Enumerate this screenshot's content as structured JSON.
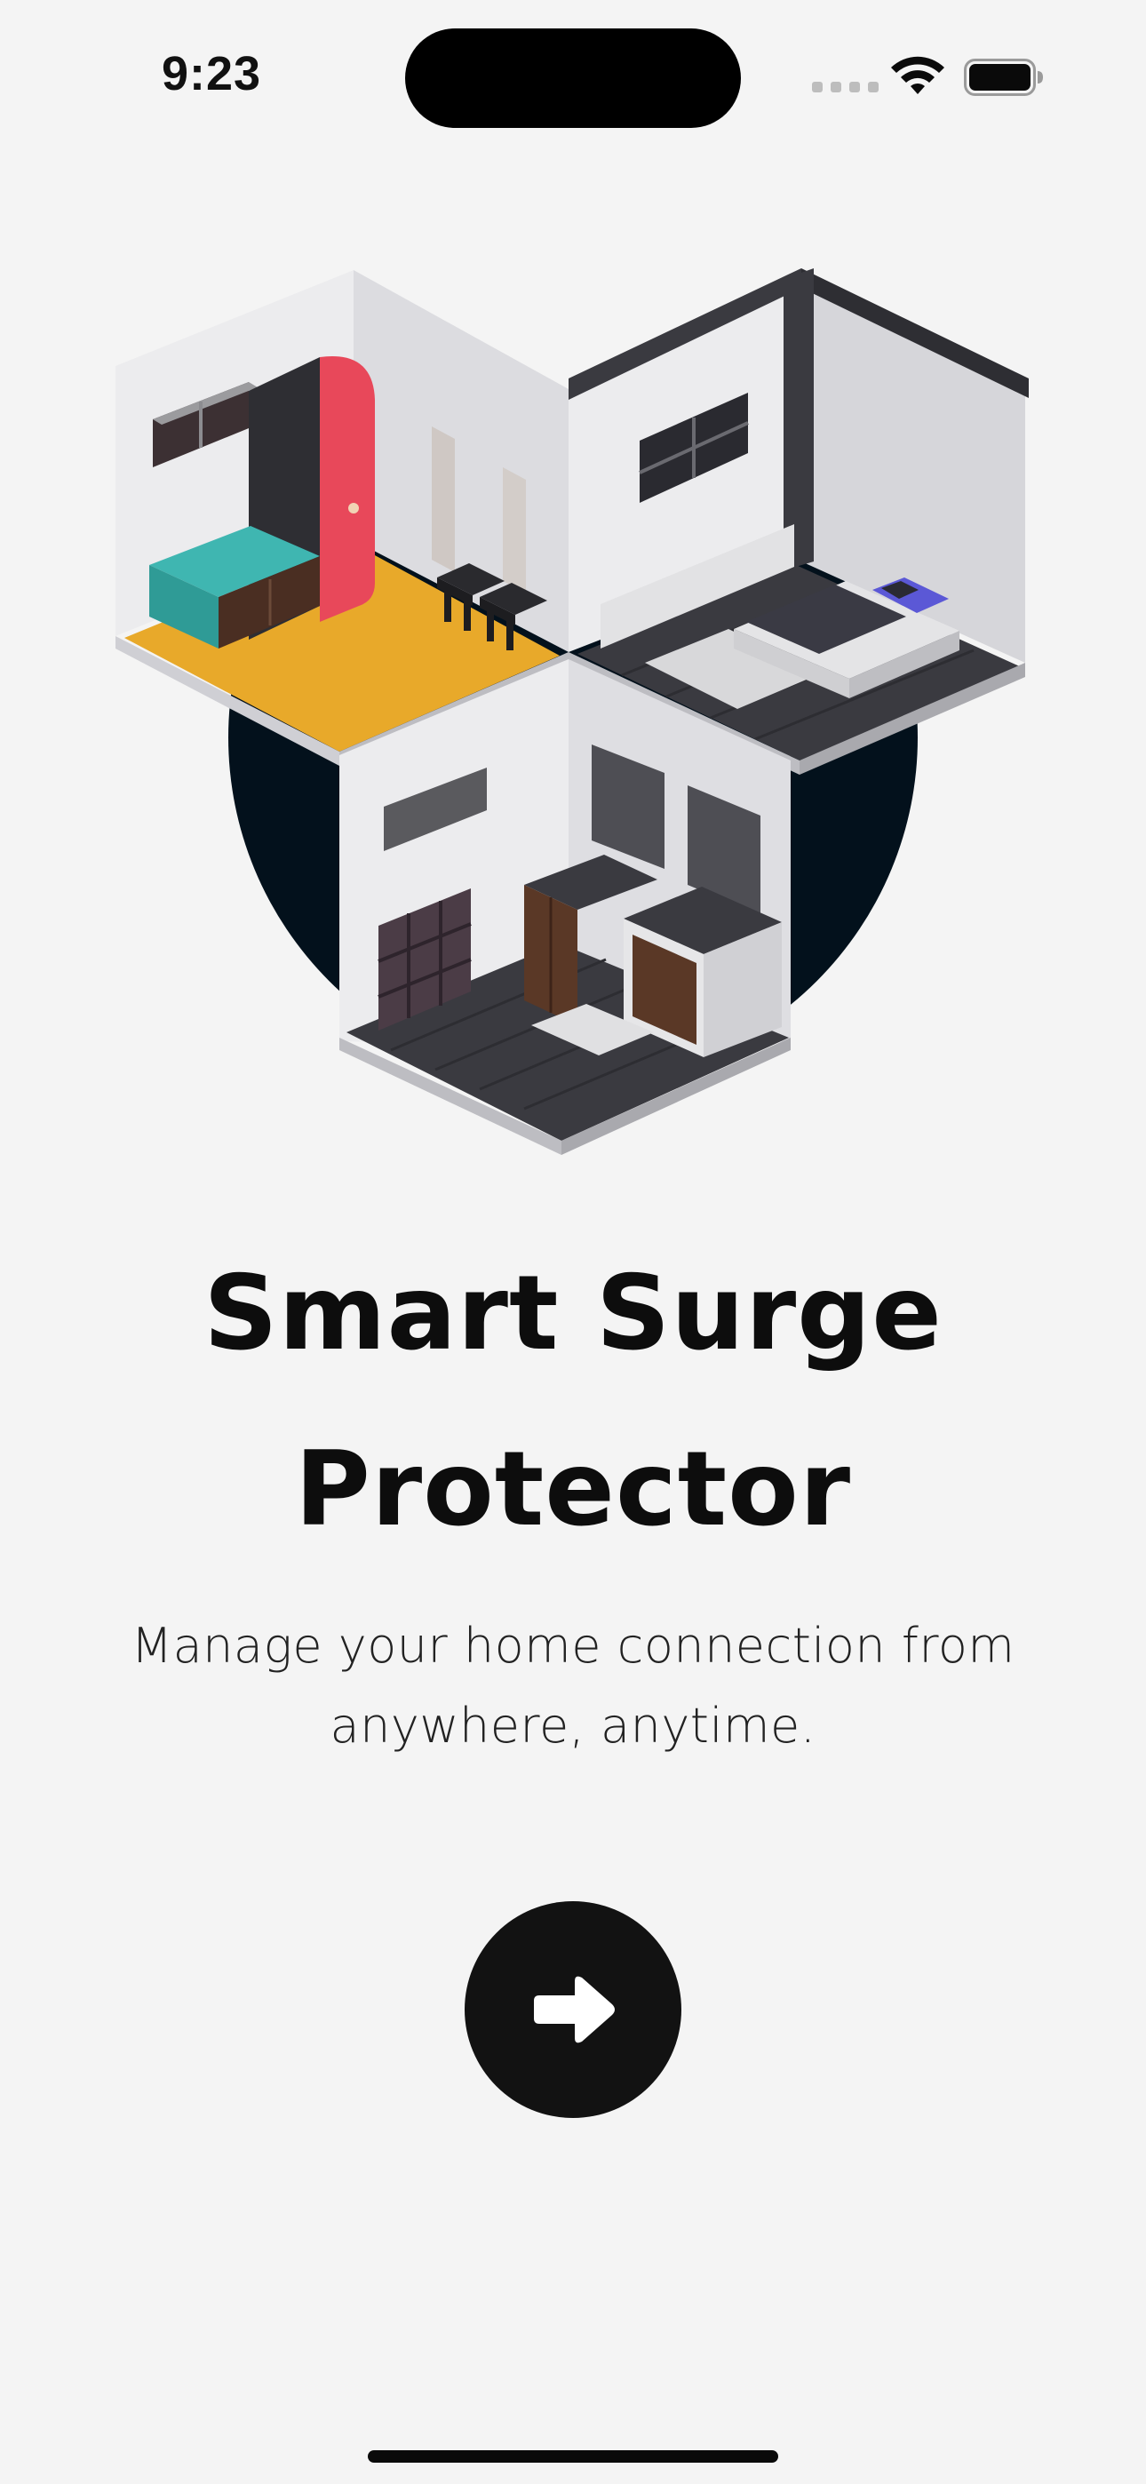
{
  "status_bar": {
    "time": "9:23"
  },
  "illustration": {
    "name": "isometric-house-rooms",
    "colors": {
      "backdrop_circle": "#03111c",
      "kitchen_floor": "#e8a92a",
      "fridge": "#e8485a",
      "counter": "#3fb6b1",
      "dark_floor": "#3a3a40",
      "wall": "#e4e4e6",
      "bed_pillow": "#5b58d6"
    }
  },
  "onboarding": {
    "title_line1": "Smart Surge",
    "title_line2": "Protector",
    "subtitle_line1": "Manage your home connection from",
    "subtitle_line2": "anywhere, anytime.",
    "next_icon": "arrow-right-icon"
  },
  "colors": {
    "background": "#f4f4f4",
    "button": "#121212",
    "text": "#0d0d0d"
  }
}
